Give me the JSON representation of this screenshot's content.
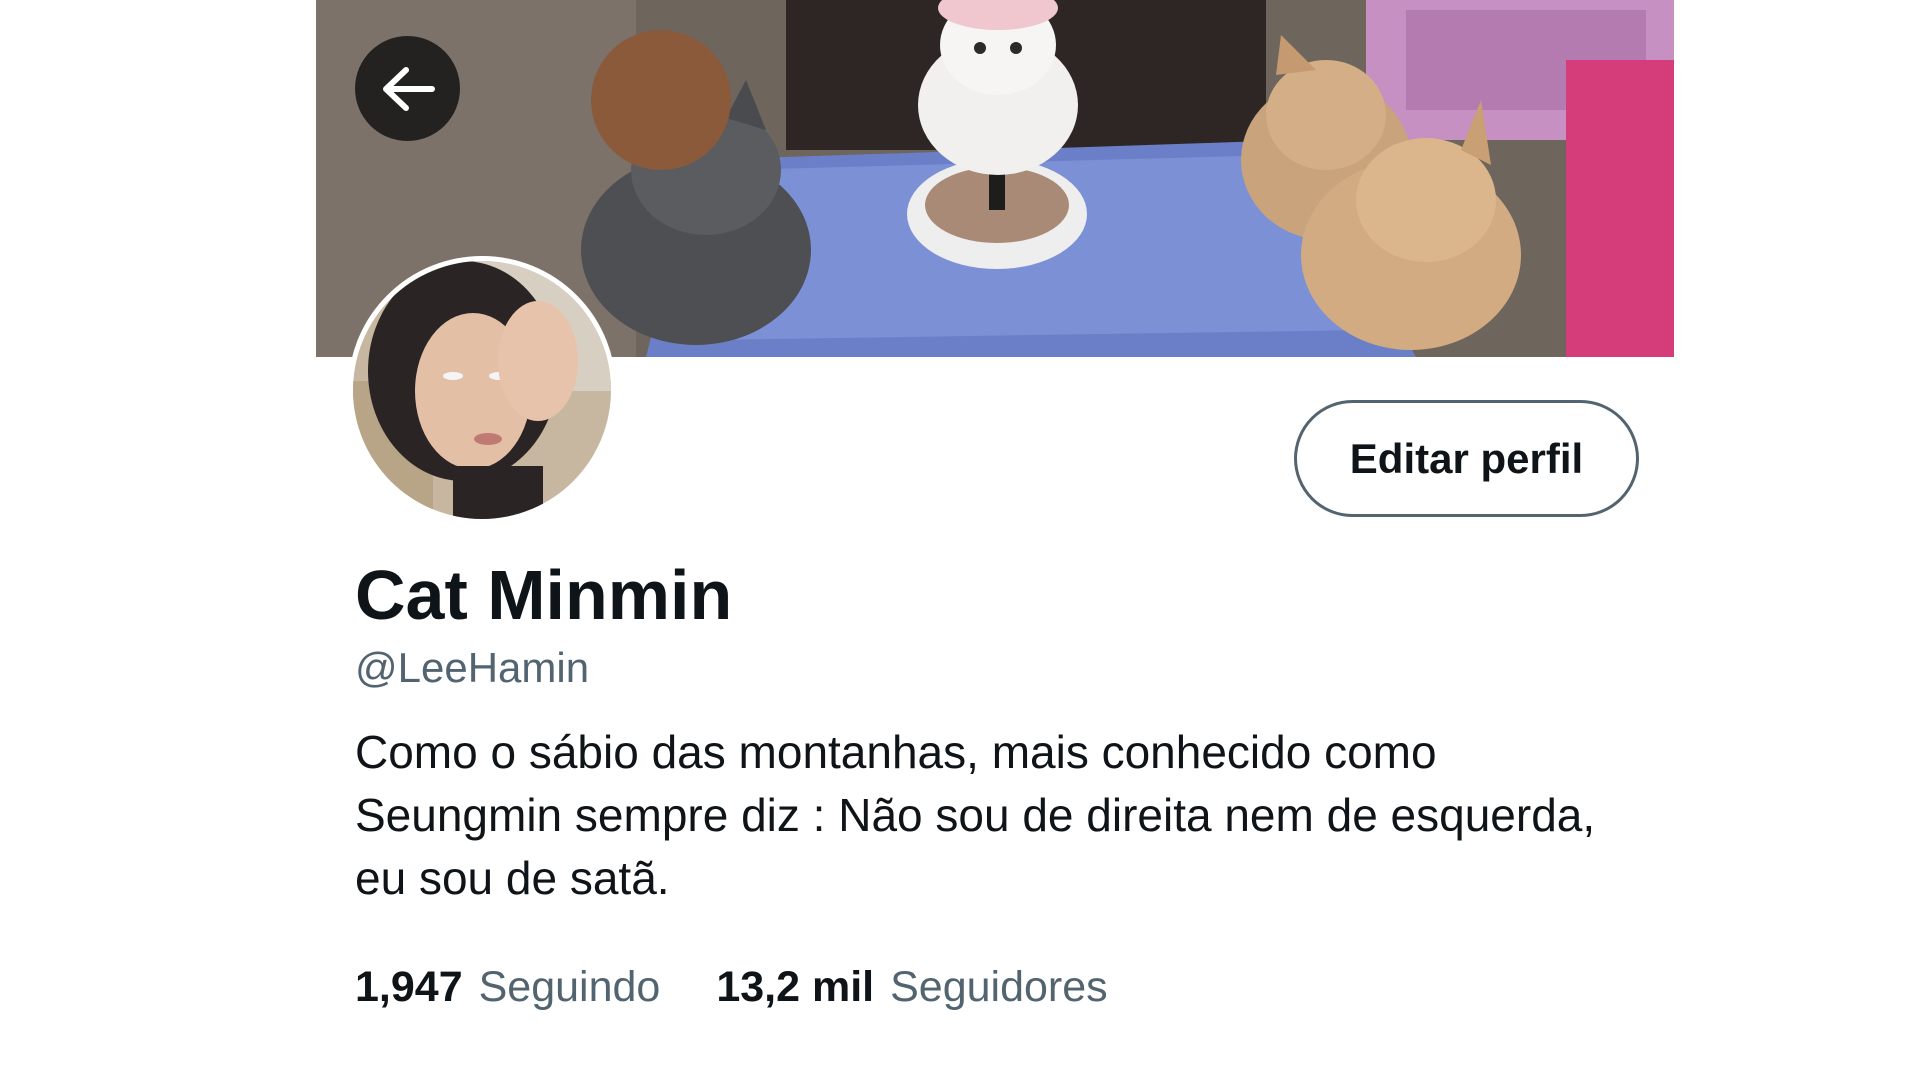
{
  "header": {
    "banner_image": "cats-birthday-party-photo",
    "back_icon": "arrow-left-icon"
  },
  "profile": {
    "avatar_image": "profile-photo",
    "edit_button_label": "Editar perfil",
    "display_name": "Cat Minmin",
    "handle": "@LeeHamin",
    "bio": "Como o sábio das montanhas, mais conhecido como Seungmin sempre diz : Não sou de direita nem de esquerda, eu sou de satã."
  },
  "stats": {
    "following_count": "1,947",
    "following_label": "Seguindo",
    "followers_count": "13,2 mil",
    "followers_label": "Seguidores"
  },
  "colors": {
    "text_primary": "#0f1419",
    "text_secondary": "#536471",
    "button_border": "#536471",
    "background": "#ffffff"
  }
}
